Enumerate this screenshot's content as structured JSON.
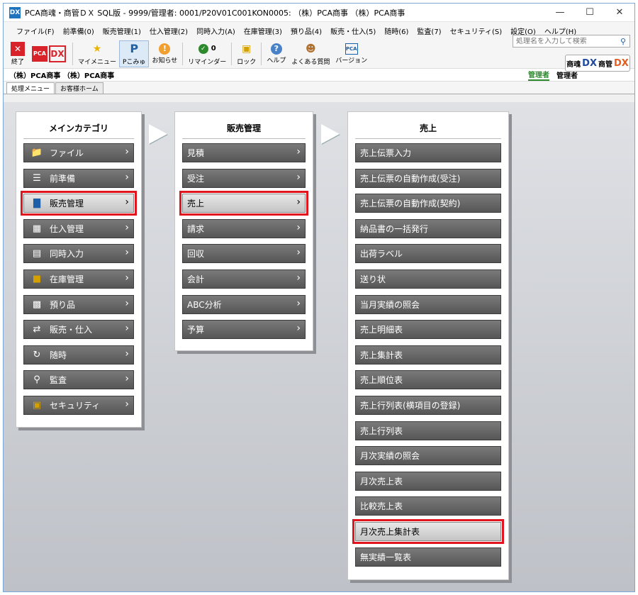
{
  "window": {
    "app_icon": "DX",
    "title": "PCA商魂・商管ＤＸ SQL版 - 9999/管理者: 0001/P20V01C001KON0005: （株）PCA商事 （株）PCA商事",
    "minimize": "—",
    "maximize": "☐",
    "close": "✕"
  },
  "menu": {
    "items": [
      "ファイル(F)",
      "前準備(0)",
      "販売管理(1)",
      "仕入管理(2)",
      "同時入力(A)",
      "在庫管理(3)",
      "預り品(4)",
      "販売・仕入(5)",
      "随時(6)",
      "監査(7)",
      "セキュリティ(S)",
      "設定(O)",
      "ヘルプ(H)"
    ],
    "search_placeholder": "処理名を入力して検索"
  },
  "toolbar": {
    "exit": "終了",
    "logo_mark": "PCA",
    "logo_dx": "DX",
    "mymenu": "マイメニュー",
    "pkomyu": "Pこみゅ",
    "notice": "お知らせ",
    "reminder": "リマインダー",
    "reminder_count": "0",
    "lock": "ロック",
    "help": "ヘルプ",
    "faq": "よくある質問",
    "version": "バージョン",
    "version_icon_text": "PCA"
  },
  "brand": {
    "left": "商魂",
    "dx1": "DX",
    "mid": "商管",
    "dx2": "DX"
  },
  "company": {
    "name": "（株）PCA商事 （株）PCA商事",
    "role_badge": "管理者",
    "role_user": "管理者"
  },
  "tabs": [
    "処理メニュー",
    "お客様ホーム"
  ],
  "panels": {
    "main_category": {
      "title": "メインカテゴリ",
      "items": [
        "ファイル",
        "前準備",
        "販売管理",
        "仕入管理",
        "同時入力",
        "在庫管理",
        "預り品",
        "販売・仕入",
        "随時",
        "監査",
        "セキュリティ"
      ]
    },
    "sales_mgmt": {
      "title": "販売管理",
      "items": [
        "見積",
        "受注",
        "売上",
        "請求",
        "回収",
        "会計",
        "ABC分析",
        "予算"
      ]
    },
    "sales": {
      "title": "売上",
      "items": [
        "売上伝票入力",
        "売上伝票の自動作成(受注)",
        "売上伝票の自動作成(契約)",
        "納品書の一括発行",
        "出荷ラベル",
        "送り状",
        "当月実績の照会",
        "売上明細表",
        "売上集計表",
        "売上順位表",
        "売上行列表(横項目の登録)",
        "売上行列表",
        "月次実績の照会",
        "月次売上表",
        "比較売上表",
        "月次売上集計表",
        "無実績一覧表"
      ]
    }
  },
  "colors": {
    "highlight": "#e2141e",
    "item_bg": "#5f5f5f",
    "selected_bg": "#d6d6d6"
  }
}
